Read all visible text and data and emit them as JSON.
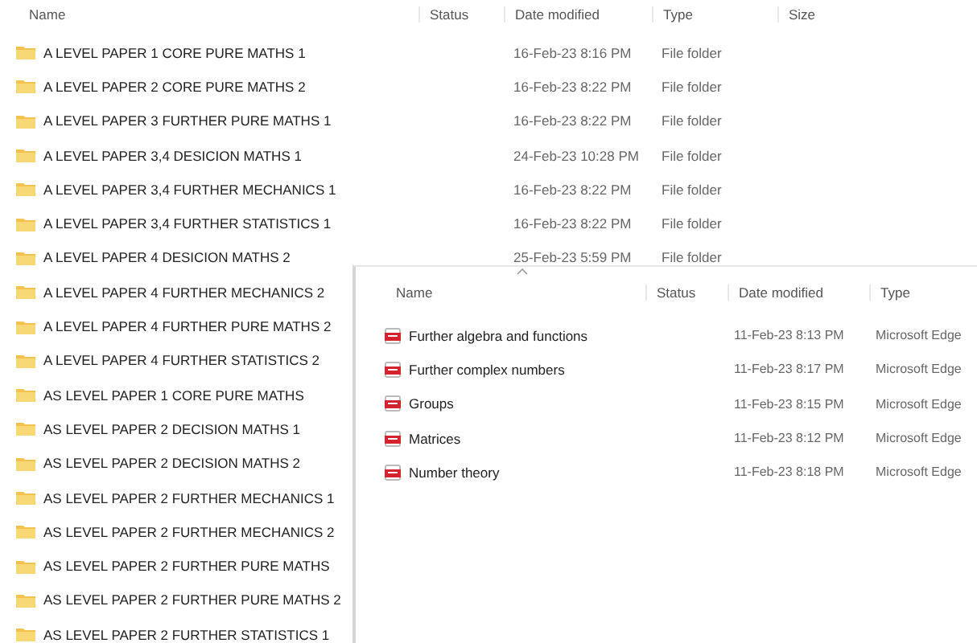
{
  "back_window": {
    "columns": [
      "Name",
      "Status",
      "Date modified",
      "Type",
      "Size"
    ],
    "rows": [
      {
        "name": "A LEVEL PAPER 1 CORE PURE MATHS 1",
        "date_modified": "16-Feb-23 8:16 PM",
        "type": "File folder"
      },
      {
        "name": "A LEVEL PAPER 2 CORE PURE MATHS 2",
        "date_modified": "16-Feb-23 8:22 PM",
        "type": "File folder"
      },
      {
        "name": "A LEVEL PAPER 3 FURTHER PURE MATHS 1",
        "date_modified": "16-Feb-23 8:22 PM",
        "type": "File folder"
      },
      {
        "name": "A LEVEL PAPER 3,4 DESICION  MATHS 1",
        "date_modified": "24-Feb-23 10:28 PM",
        "type": "File folder"
      },
      {
        "name": "A LEVEL PAPER 3,4 FURTHER MECHANICS 1",
        "date_modified": "16-Feb-23 8:22 PM",
        "type": "File folder"
      },
      {
        "name": "A LEVEL PAPER 3,4 FURTHER STATISTICS 1",
        "date_modified": "16-Feb-23 8:22 PM",
        "type": "File folder"
      },
      {
        "name": "A LEVEL PAPER 4 DESICION MATHS 2",
        "date_modified": "25-Feb-23 5:59 PM",
        "type": "File folder"
      },
      {
        "name": "A LEVEL PAPER 4 FURTHER MECHANICS 2"
      },
      {
        "name": "A LEVEL PAPER 4 FURTHER PURE MATHS 2"
      },
      {
        "name": "A LEVEL PAPER 4 FURTHER STATISTICS 2"
      },
      {
        "name": "AS LEVEL PAPER 1 CORE PURE MATHS"
      },
      {
        "name": "AS LEVEL PAPER 2 DECISION MATHS 1"
      },
      {
        "name": "AS LEVEL PAPER 2 DECISION MATHS 2"
      },
      {
        "name": "AS LEVEL PAPER 2 FURTHER MECHANICS 1"
      },
      {
        "name": "AS LEVEL PAPER 2 FURTHER MECHANICS 2"
      },
      {
        "name": "AS LEVEL PAPER 2 FURTHER PURE MATHS"
      },
      {
        "name": "AS LEVEL PAPER 2 FURTHER PURE MATHS 2"
      },
      {
        "name": "AS LEVEL PAPER 2 FURTHER STATISTICS 1"
      }
    ]
  },
  "front_window": {
    "columns": [
      "Name",
      "Status",
      "Date modified",
      "Type"
    ],
    "rows": [
      {
        "name": "Further algebra and functions",
        "date_modified": "11-Feb-23 8:13 PM",
        "type": "Microsoft Edge"
      },
      {
        "name": "Further complex numbers",
        "date_modified": "11-Feb-23 8:17 PM",
        "type": "Microsoft Edge"
      },
      {
        "name": "Groups",
        "date_modified": "11-Feb-23 8:15 PM",
        "type": "Microsoft Edge"
      },
      {
        "name": "Matrices",
        "date_modified": "11-Feb-23 8:12 PM",
        "type": "Microsoft Edge"
      },
      {
        "name": "Number theory",
        "date_modified": "11-Feb-23 8:18 PM",
        "type": "Microsoft Edge"
      }
    ]
  }
}
